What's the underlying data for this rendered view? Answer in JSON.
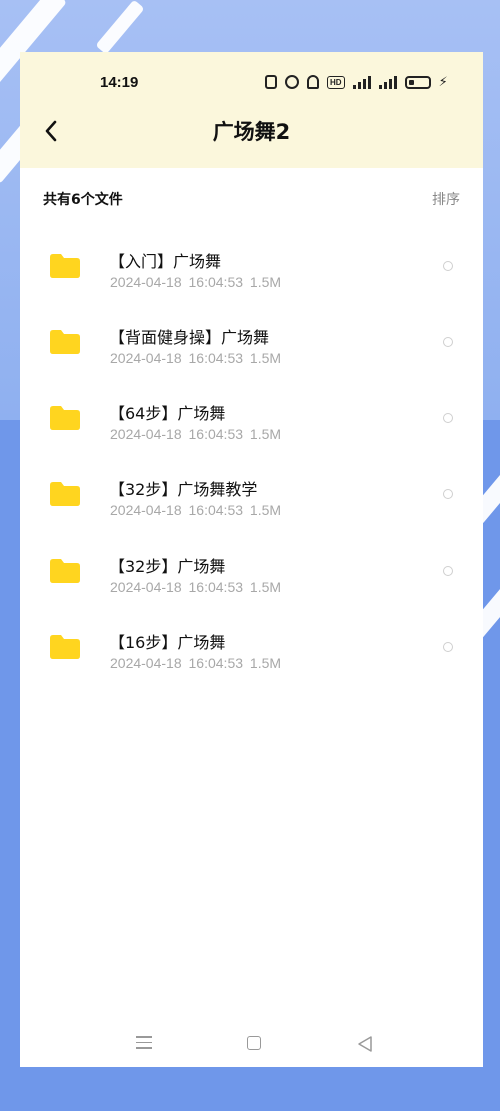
{
  "status_bar": {
    "time": "14:19",
    "icons": [
      "nfc-icon",
      "alarm-icon",
      "mute-bell-icon",
      "hd-icon",
      "4g-signal-icon",
      "5g-signal-icon",
      "battery-icon",
      "charging-icon"
    ],
    "hd_label": "HD"
  },
  "header": {
    "title": "广场舞2",
    "back_icon": "chevron-left-icon"
  },
  "toolbar": {
    "count_label": "共有6个文件",
    "sort_label": "排序"
  },
  "files": [
    {
      "name": "【入门】广场舞",
      "date": "2024-04-18",
      "time": "16:04:53",
      "size": "1.5M"
    },
    {
      "name": "【背面健身操】广场舞",
      "date": "2024-04-18",
      "time": "16:04:53",
      "size": "1.5M"
    },
    {
      "name": "【64步】广场舞",
      "date": "2024-04-18",
      "time": "16:04:53",
      "size": "1.5M"
    },
    {
      "name": "【32步】广场舞教学",
      "date": "2024-04-18",
      "time": "16:04:53",
      "size": "1.5M"
    },
    {
      "name": "【32步】广场舞",
      "date": "2024-04-18",
      "time": "16:04:53",
      "size": "1.5M"
    },
    {
      "name": "【16步】广场舞",
      "date": "2024-04-18",
      "time": "16:04:53",
      "size": "1.5M"
    }
  ],
  "colors": {
    "header_bg": "#fbf7dc",
    "folder": "#ffd51f",
    "background": "#6f97ea"
  },
  "nav_bar": {
    "icons": [
      "menu-icon",
      "home-icon",
      "back-triangle-icon"
    ]
  }
}
